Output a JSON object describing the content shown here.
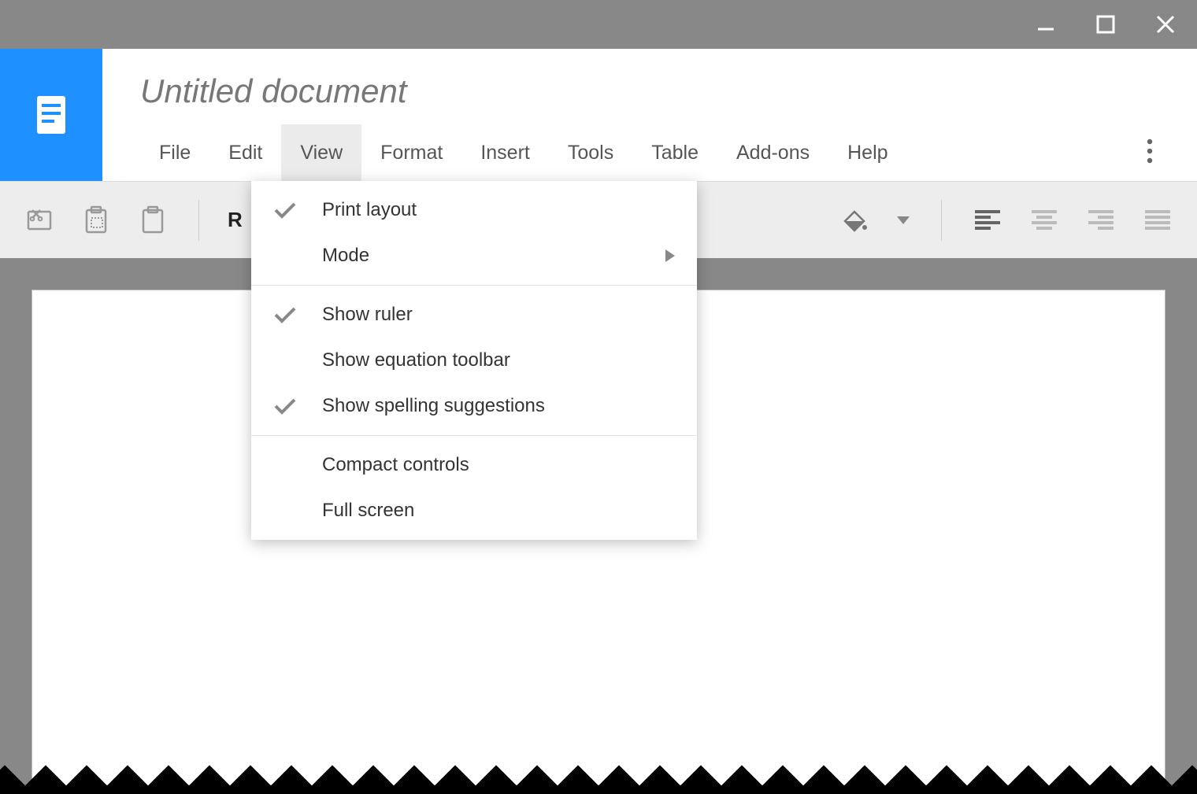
{
  "doc": {
    "title": "Untitled document"
  },
  "menus": {
    "file": "File",
    "edit": "Edit",
    "view": "View",
    "format": "Format",
    "insert": "Insert",
    "tools": "Tools",
    "table": "Table",
    "addons": "Add-ons",
    "help": "Help"
  },
  "view_menu": {
    "print_layout": "Print layout",
    "mode": "Mode",
    "show_ruler": "Show ruler",
    "show_equation_toolbar": "Show equation toolbar",
    "show_spelling": "Show spelling suggestions",
    "compact_controls": "Compact controls",
    "full_screen": "Full screen"
  },
  "toolbar": {
    "r_label": "R"
  }
}
